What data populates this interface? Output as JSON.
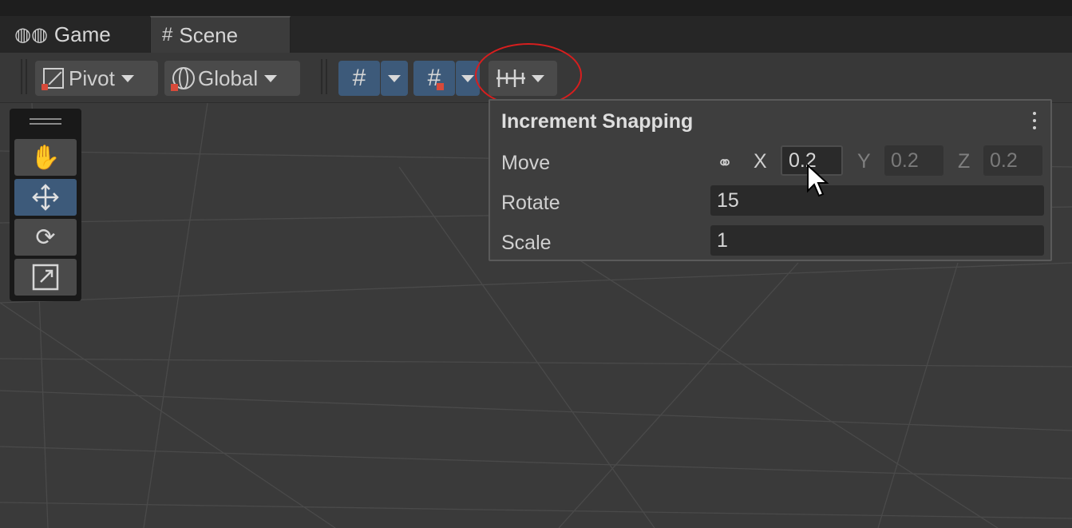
{
  "tabs": [
    {
      "label": "Game",
      "icon": "gamepad-icon"
    },
    {
      "label": "Scene",
      "icon": "hash-icon"
    }
  ],
  "toolbar": {
    "pivot_label": "Pivot",
    "global_label": "Global"
  },
  "snapping": {
    "title": "Increment Snapping",
    "move": {
      "label": "Move",
      "x_label": "X",
      "x": "0.2",
      "y_label": "Y",
      "y": "0.2",
      "z_label": "Z",
      "z": "0.2"
    },
    "rotate": {
      "label": "Rotate",
      "value": "15"
    },
    "scale": {
      "label": "Scale",
      "value": "1"
    }
  },
  "tools": [
    "hand-icon",
    "move-icon",
    "rotate-icon",
    "scale-icon"
  ],
  "colors": {
    "accent": "#3d5a7a",
    "highlight": "#d81e1e",
    "background": "#3a3a3a"
  }
}
